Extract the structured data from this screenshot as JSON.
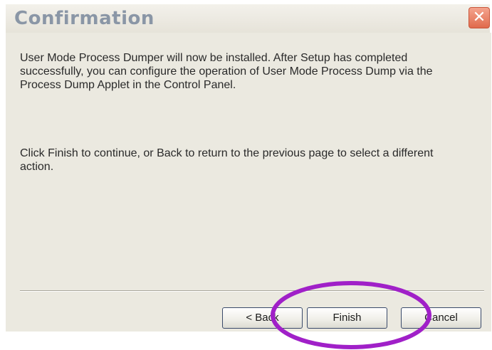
{
  "window": {
    "title": "Confirmation",
    "close_glyph": "✕"
  },
  "content": {
    "paragraph_1": "User Mode Process Dumper will now be installed. After Setup has completed successfully, you can configure the operation of User Mode Process Dump via the Process Dump Applet in the Control Panel.",
    "paragraph_2": "Click Finish to continue, or Back to return to the previous page to select a different action."
  },
  "buttons": {
    "back_label": "< Back",
    "finish_label": "Finish",
    "cancel_label": "Cancel"
  },
  "annotation": {
    "type": "highlight-ellipse",
    "color": "#a020c8",
    "target": "finish-button"
  }
}
